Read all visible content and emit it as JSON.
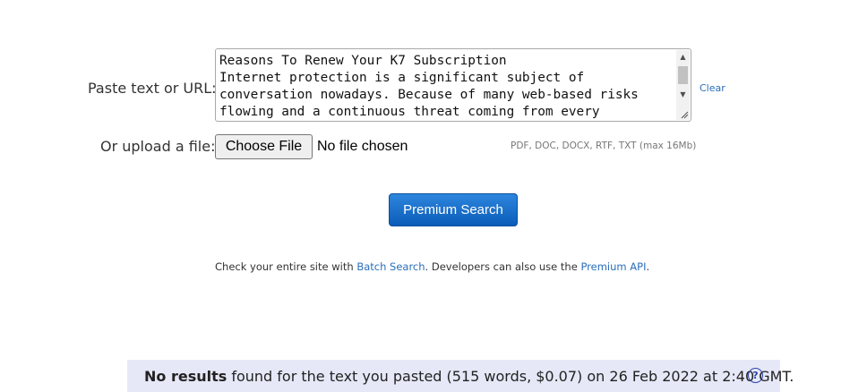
{
  "form": {
    "paste_label": "Paste text or URL:",
    "textarea_value": "Reasons To Renew Your K7 Subscription\nInternet protection is a significant subject of\nconversation nowadays. Because of many web-based risks\nflowing and a continuous threat coming from every",
    "clear_label": "Clear",
    "upload_label": "Or upload a file:",
    "choose_file_label": "Choose File",
    "no_file_text": "No file chosen",
    "formats_text": "PDF, DOC, DOCX, RTF, TXT (max 16Mb)",
    "search_button_label": "Premium Search"
  },
  "batch": {
    "prefix": "Check your entire site with ",
    "batch_link": "Batch Search",
    "middle": ". Developers can also use the ",
    "api_link": "Premium API",
    "suffix": "."
  },
  "result": {
    "bold": "No results",
    "text": " found for the text you pasted (515 words, $0.07) on 26 Feb 2022 at 2:40 GMT.",
    "help_icon_glyph": "?"
  },
  "icons": {
    "scroll_up": "scroll-up-arrow-icon",
    "scroll_down": "scroll-down-arrow-icon",
    "resize": "resize-grip-icon",
    "help": "help-icon"
  },
  "colors": {
    "link": "#2a6ebb",
    "button_gradient_top": "#2d86dd",
    "button_gradient_bottom": "#0b5cb8",
    "result_bar_bg": "#e6e8f7"
  }
}
